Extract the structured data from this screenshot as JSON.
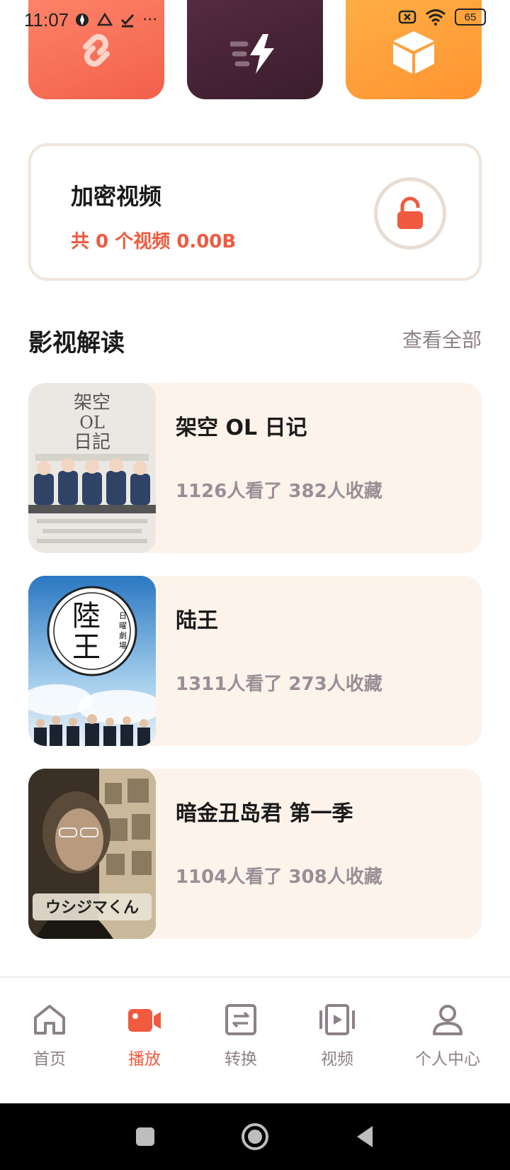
{
  "status_bar": {
    "time": "11:07",
    "battery": "65"
  },
  "tiles": [
    {
      "icon": "link-break-icon",
      "color": "#f2604a"
    },
    {
      "icon": "fast-bolt-icon",
      "color": "#3a1d2c"
    },
    {
      "icon": "box-icon",
      "color": "#ff9431"
    }
  ],
  "encrypted": {
    "title": "加密视频",
    "summary": "共 0 个视频 0.00B"
  },
  "section": {
    "title": "影视解读",
    "see_all": "查看全部"
  },
  "items": [
    {
      "title": "架空 OL 日记",
      "stats": "1126人看了 382人收藏"
    },
    {
      "title": "陆王",
      "stats": "1311人看了 273人收藏"
    },
    {
      "title": "暗金丑岛君 第一季",
      "stats": "1104人看了 308人收藏"
    }
  ],
  "posters": {
    "p1_text": "架空\nOL\n日記",
    "p2_text": "陸王",
    "p2_side": "日曜劇場",
    "p3_text": "ウシジマくん"
  },
  "nav": [
    {
      "label": "首页",
      "icon": "home-icon"
    },
    {
      "label": "播放",
      "icon": "camera-icon",
      "active": true
    },
    {
      "label": "转换",
      "icon": "convert-icon"
    },
    {
      "label": "视频",
      "icon": "video-icon"
    },
    {
      "label": "个人中心",
      "icon": "user-icon"
    }
  ],
  "colors": {
    "accent": "#f05a3e",
    "card_bg": "#fdf3ea",
    "muted": "#8e8089"
  }
}
